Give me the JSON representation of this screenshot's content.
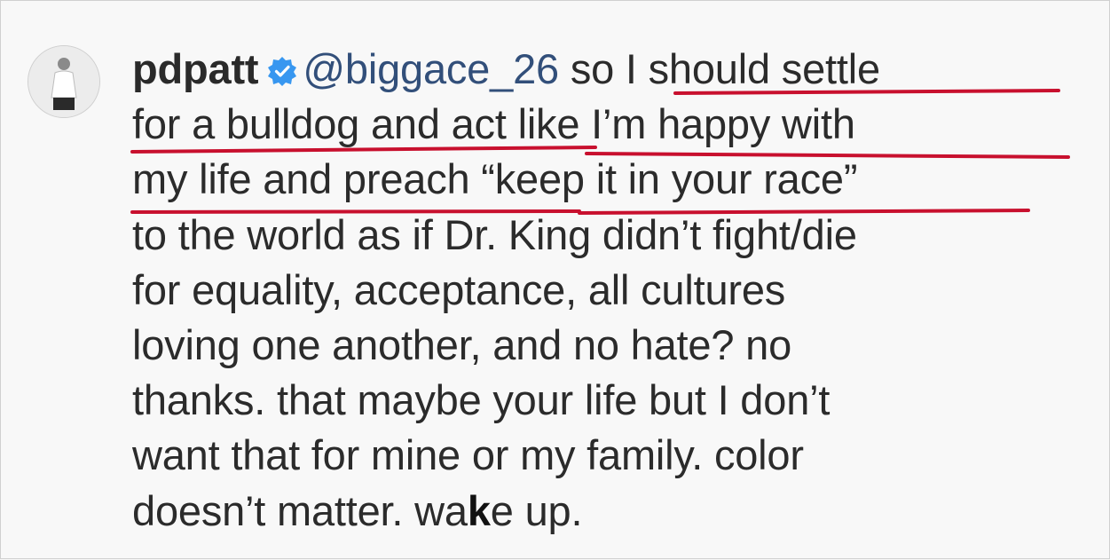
{
  "comment": {
    "username": "pdpatt",
    "mention": "@biggace_26",
    "lines": [
      "so I should settle",
      "for a bulldog and act like I’m happy with",
      "my life and preach “keep it in your race”",
      "to the world as if Dr. King didn’t fight/die",
      "for equality, acceptance, all cultures",
      "loving one another, and no hate? no",
      "thanks. that maybe your life but I don’t",
      "want that for mine or my family. color"
    ],
    "last_line_before": "doesn’t matter. wa",
    "last_line_k": "k",
    "last_line_after": "e up."
  },
  "icons": {
    "verified": "verified-badge-icon",
    "avatar": "avatar"
  },
  "colors": {
    "text": "#2b2b2b",
    "mention": "#324f7a",
    "verified": "#3897f0",
    "underline": "#c8102e",
    "background": "#f8f8f8"
  }
}
